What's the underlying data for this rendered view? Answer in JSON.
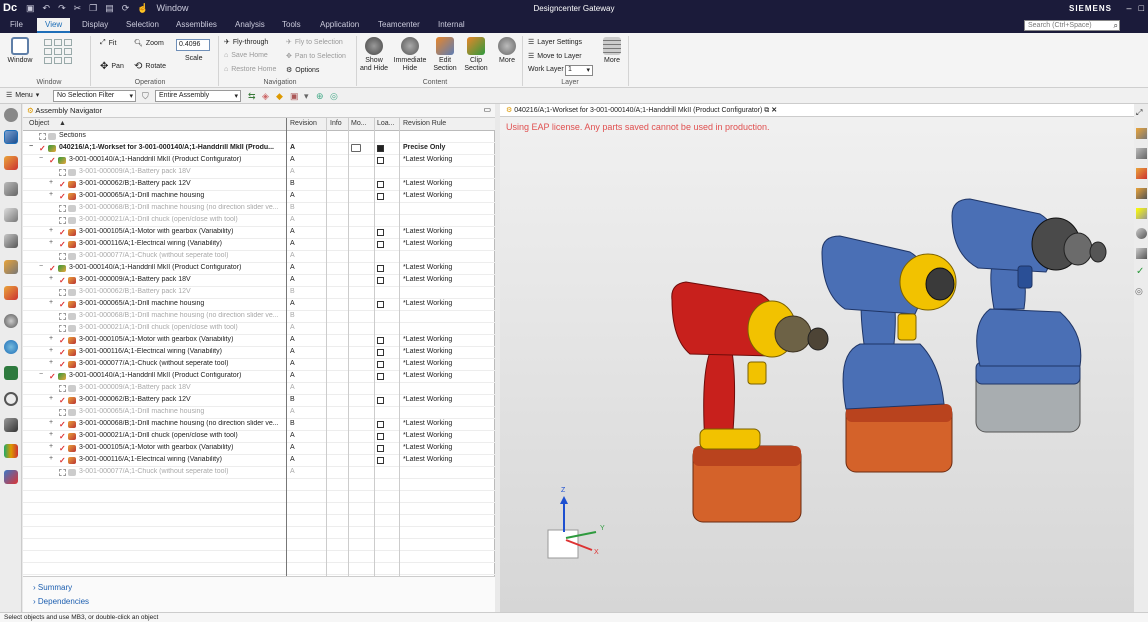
{
  "app": {
    "logo": "Dc",
    "window_menu": "Window",
    "title": "Designcenter Gateway",
    "brand": "SIEMENS",
    "search_placeholder": "Search (Ctrl+Space)"
  },
  "tabs": [
    "File",
    "View",
    "Display",
    "Selection",
    "Assemblies",
    "Analysis",
    "Tools",
    "Application",
    "Teamcenter",
    "Internal"
  ],
  "active_tab": "View",
  "ribbon": {
    "window": "Window",
    "window_group": "Window",
    "fit": "Fit",
    "zoom": "Zoom",
    "zoom_value": "0.4096",
    "scale": "Scale",
    "pan": "Pan",
    "rotate": "Rotate",
    "operation_group": "Operation",
    "fly_through": "Fly-through",
    "fly_to_selection": "Fly to Selection",
    "save_home": "Save Home",
    "pan_to_selection": "Pan to Selection",
    "restore_home": "Restore Home",
    "options": "Options",
    "navigation_group": "Navigation",
    "show_hide": "Show and Hide",
    "immediate_hide": "Immediate Hide",
    "edit_section": "Edit Section",
    "clip_section": "Clip Section",
    "more": "More",
    "content_group": "Content",
    "layer_settings": "Layer Settings",
    "move_to_layer": "Move to Layer",
    "work_layer": "Work Layer",
    "work_layer_value": "1",
    "more2": "More",
    "layer_group": "Layer"
  },
  "filterbar": {
    "menu": "Menu",
    "selection_filter": "No Selection Filter",
    "assembly_scope": "Entire Assembly"
  },
  "navigator": {
    "title": "Assembly Navigator",
    "columns": {
      "object": "Object",
      "revision": "Revision",
      "info": "Info",
      "mo": "Mo...",
      "loa": "Loa...",
      "rule": "Revision Rule"
    },
    "rows": [
      {
        "indent": 1,
        "name": "Sections",
        "rev": "",
        "rule": "",
        "state": "plain",
        "load": ""
      },
      {
        "indent": 1,
        "name": "040216/A;1-Workset for 3-001-000140/A;1-Handdrill MkII (Produ...",
        "rev": "A",
        "rule": "Precise Only",
        "state": "bold",
        "load": "fill",
        "mo": true
      },
      {
        "indent": 2,
        "name": "3-001-000140/A;1-Handdrill MkII (Product Configurator)",
        "rev": "A",
        "rule": "*Latest Working",
        "state": "root",
        "load": "open"
      },
      {
        "indent": 3,
        "name": "3-001-000009/A;1-Battery pack 18V",
        "rev": "A",
        "rule": "",
        "state": "dim",
        "load": ""
      },
      {
        "indent": 3,
        "name": "3-001-000062/B;1-Battery pack 12V",
        "rev": "B",
        "rule": "*Latest Working",
        "state": "on",
        "load": "open"
      },
      {
        "indent": 3,
        "name": "3-001-000065/A;1-Drill machine housing",
        "rev": "A",
        "rule": "*Latest Working",
        "state": "on",
        "load": "open"
      },
      {
        "indent": 3,
        "name": "3-001-000068/B;1-Drill machine housing (no direction slider ve...",
        "rev": "B",
        "rule": "",
        "state": "dim",
        "load": ""
      },
      {
        "indent": 3,
        "name": "3-001-000021/A;1-Drill chuck (open/close with tool)",
        "rev": "A",
        "rule": "",
        "state": "dim",
        "load": ""
      },
      {
        "indent": 3,
        "name": "3-001-000105/A;1-Motor with gearbox (Variability)",
        "rev": "A",
        "rule": "*Latest Working",
        "state": "on",
        "load": "open"
      },
      {
        "indent": 3,
        "name": "3-001-000116/A;1-Electrical wiring (Variability)",
        "rev": "A",
        "rule": "*Latest Working",
        "state": "on",
        "load": "open"
      },
      {
        "indent": 3,
        "name": "3-001-000077/A;1-Chuck (without seperate tool)",
        "rev": "A",
        "rule": "",
        "state": "dim",
        "load": ""
      },
      {
        "indent": 2,
        "name": "3-001-000140/A;1-Handdrill MkII (Product Configurator)",
        "rev": "A",
        "rule": "*Latest Working",
        "state": "root",
        "load": "open"
      },
      {
        "indent": 3,
        "name": "3-001-000009/A;1-Battery pack 18V",
        "rev": "A",
        "rule": "*Latest Working",
        "state": "on",
        "load": "open"
      },
      {
        "indent": 3,
        "name": "3-001-000062/B;1-Battery pack 12V",
        "rev": "B",
        "rule": "",
        "state": "dim",
        "load": ""
      },
      {
        "indent": 3,
        "name": "3-001-000065/A;1-Drill machine housing",
        "rev": "A",
        "rule": "*Latest Working",
        "state": "on",
        "load": "open"
      },
      {
        "indent": 3,
        "name": "3-001-000068/B;1-Drill machine housing (no direction slider ve...",
        "rev": "B",
        "rule": "",
        "state": "dim",
        "load": ""
      },
      {
        "indent": 3,
        "name": "3-001-000021/A;1-Drill chuck (open/close with tool)",
        "rev": "A",
        "rule": "",
        "state": "dim",
        "load": ""
      },
      {
        "indent": 3,
        "name": "3-001-000105/A;1-Motor with gearbox (Variability)",
        "rev": "A",
        "rule": "*Latest Working",
        "state": "on",
        "load": "open"
      },
      {
        "indent": 3,
        "name": "3-001-000116/A;1-Electrical wiring (Variability)",
        "rev": "A",
        "rule": "*Latest Working",
        "state": "on",
        "load": "open"
      },
      {
        "indent": 3,
        "name": "3-001-000077/A;1-Chuck (without seperate tool)",
        "rev": "A",
        "rule": "*Latest Working",
        "state": "on",
        "load": "open"
      },
      {
        "indent": 2,
        "name": "3-001-000140/A;1-Handdrill MkII (Product Configurator)",
        "rev": "A",
        "rule": "*Latest Working",
        "state": "root",
        "load": "open"
      },
      {
        "indent": 3,
        "name": "3-001-000009/A;1-Battery pack 18V",
        "rev": "A",
        "rule": "",
        "state": "dim",
        "load": ""
      },
      {
        "indent": 3,
        "name": "3-001-000062/B;1-Battery pack 12V",
        "rev": "B",
        "rule": "*Latest Working",
        "state": "on",
        "load": "open"
      },
      {
        "indent": 3,
        "name": "3-001-000065/A;1-Drill machine housing",
        "rev": "A",
        "rule": "",
        "state": "dim",
        "load": ""
      },
      {
        "indent": 3,
        "name": "3-001-000068/B;1-Drill machine housing (no direction slider ve...",
        "rev": "B",
        "rule": "*Latest Working",
        "state": "on",
        "load": "open"
      },
      {
        "indent": 3,
        "name": "3-001-000021/A;1-Drill chuck (open/close with tool)",
        "rev": "A",
        "rule": "*Latest Working",
        "state": "on",
        "load": "open"
      },
      {
        "indent": 3,
        "name": "3-001-000105/A;1-Motor with gearbox (Variability)",
        "rev": "A",
        "rule": "*Latest Working",
        "state": "on",
        "load": "open"
      },
      {
        "indent": 3,
        "name": "3-001-000116/A;1-Electrical wiring (Variability)",
        "rev": "A",
        "rule": "*Latest Working",
        "state": "on",
        "load": "open"
      },
      {
        "indent": 3,
        "name": "3-001-000077/A;1-Chuck (without seperate tool)",
        "rev": "A",
        "rule": "",
        "state": "dim",
        "load": ""
      }
    ],
    "summary": "Summary",
    "dependencies": "Dependencies"
  },
  "viewport": {
    "tab_title": "040216/A;1-Workset for 3-001-000140/A;1-Handdrill MkII (Product Configurator)",
    "warning": "Using EAP license. Any parts saved cannot be used in production.",
    "axes": {
      "z": "Z",
      "y": "Y",
      "x": "X"
    }
  },
  "colors": {
    "accent": "#1d6eb8",
    "titlebar": "#1b1b3a",
    "warning": "#e05050",
    "check": "#d33",
    "drill_red": "#c8201c",
    "drill_yellow": "#f2c200",
    "drill_blue": "#4a6fb5",
    "battery_orange": "#d4622a",
    "battery_grey": "#a8adb0"
  },
  "status": "Select objects and use MB3, or double-click an object"
}
